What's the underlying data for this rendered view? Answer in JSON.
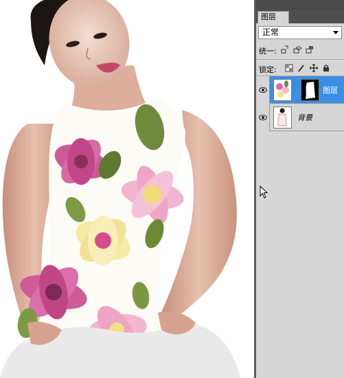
{
  "panel": {
    "tab_label": "图层",
    "blend_mode": "正常",
    "unify_label": "统一:",
    "lock_label": "锁定:",
    "layers": [
      {
        "name": "图层",
        "selected": true,
        "has_mask": true
      },
      {
        "name": "背景",
        "selected": false,
        "has_mask": false
      }
    ]
  },
  "icons": {
    "eye": "eye-icon",
    "unify_position": "unify-position-icon",
    "unify_visibility": "unify-visibility-icon",
    "unify_style": "unify-style-icon",
    "lock_transparent": "lock-transparent-icon",
    "lock_paint": "lock-paint-icon",
    "lock_move": "lock-move-icon",
    "lock_all": "lock-all-icon",
    "cursor": "mouse-cursor-icon"
  },
  "colors": {
    "selection": "#3a8ee6",
    "panel_bg": "#d6d6d6",
    "panel_header": "#4a4a4a"
  }
}
